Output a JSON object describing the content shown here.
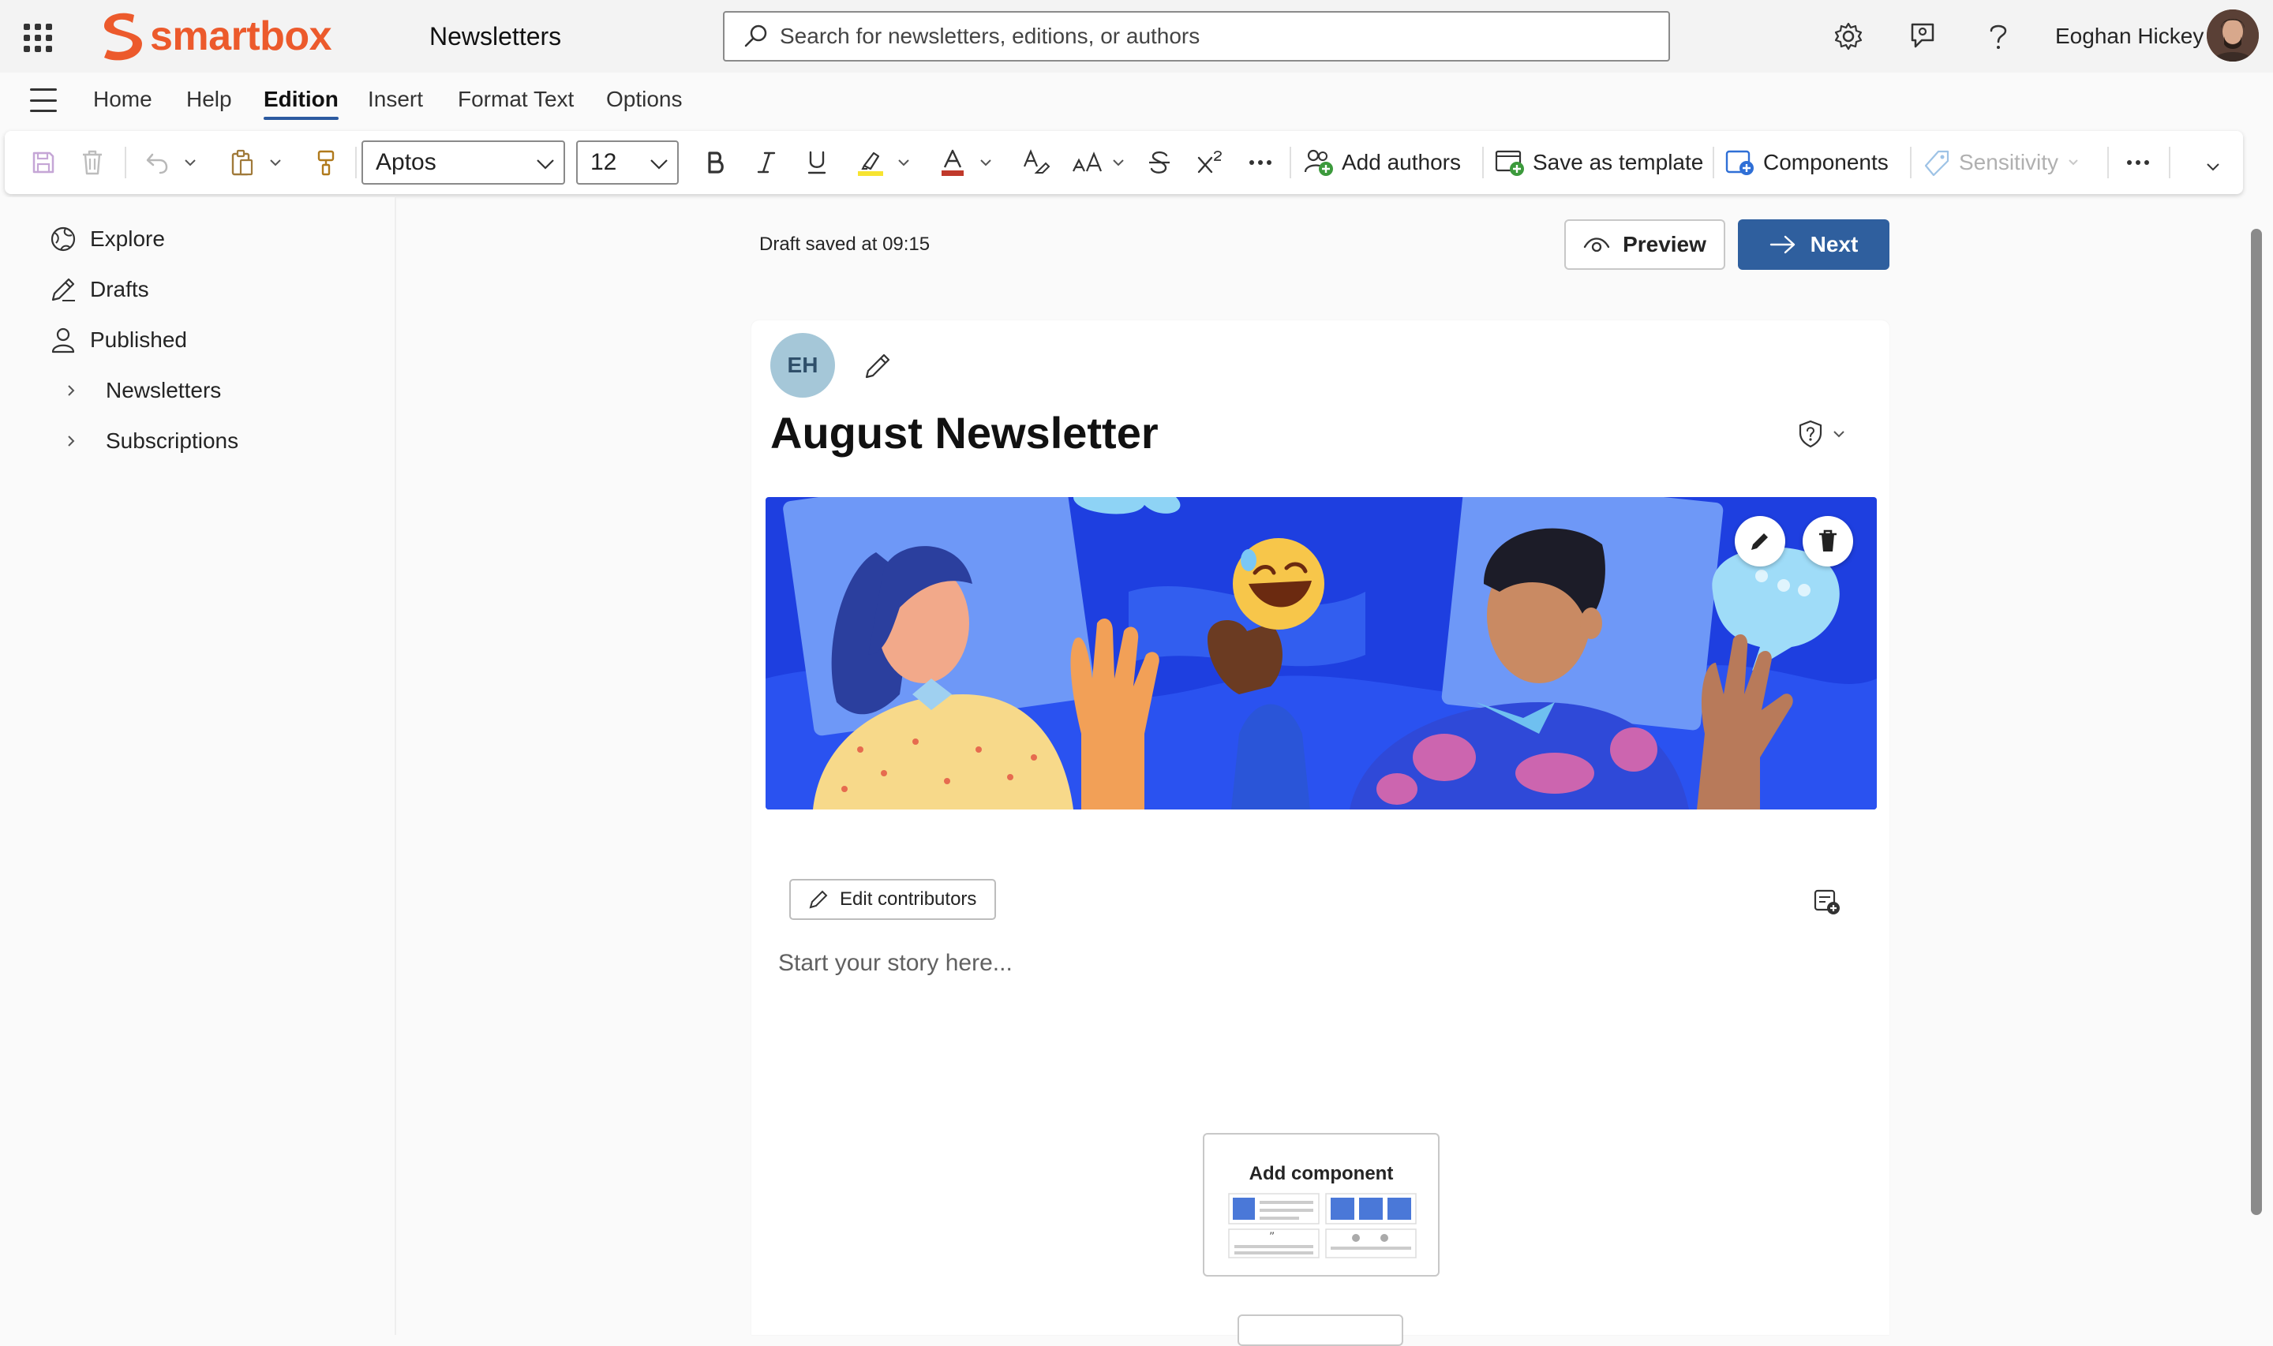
{
  "header": {
    "brand_name": "smartbox",
    "app_title": "Newsletters",
    "search_placeholder": "Search for newsletters, editions, or authors",
    "user_name": "Eoghan Hickey",
    "brand_color": "#ec5a2c"
  },
  "ribbon": {
    "tabs": [
      {
        "label": "Home"
      },
      {
        "label": "Help"
      },
      {
        "label": "Edition",
        "active": true
      },
      {
        "label": "Insert"
      },
      {
        "label": "Format Text"
      },
      {
        "label": "Options"
      }
    ]
  },
  "toolbar": {
    "font_family": "Aptos",
    "font_size": "12",
    "add_authors": "Add authors",
    "save_as_template": "Save as template",
    "components": "Components",
    "sensitivity": "Sensitivity"
  },
  "nav": {
    "items": [
      {
        "label": "Explore",
        "icon": "globe-icon"
      },
      {
        "label": "Drafts",
        "icon": "pencil-icon"
      },
      {
        "label": "Published",
        "icon": "person-icon"
      }
    ],
    "groups": [
      {
        "label": "Newsletters"
      },
      {
        "label": "Subscriptions"
      }
    ]
  },
  "editor": {
    "draft_status": "Draft saved at 09:15",
    "preview_label": "Preview",
    "next_label": "Next",
    "author_initials": "EH",
    "title": "August Newsletter",
    "edit_contributors": "Edit contributors",
    "story_placeholder": "Start your story here...",
    "add_component": "Add component",
    "accent_color": "#2f5f9e"
  }
}
